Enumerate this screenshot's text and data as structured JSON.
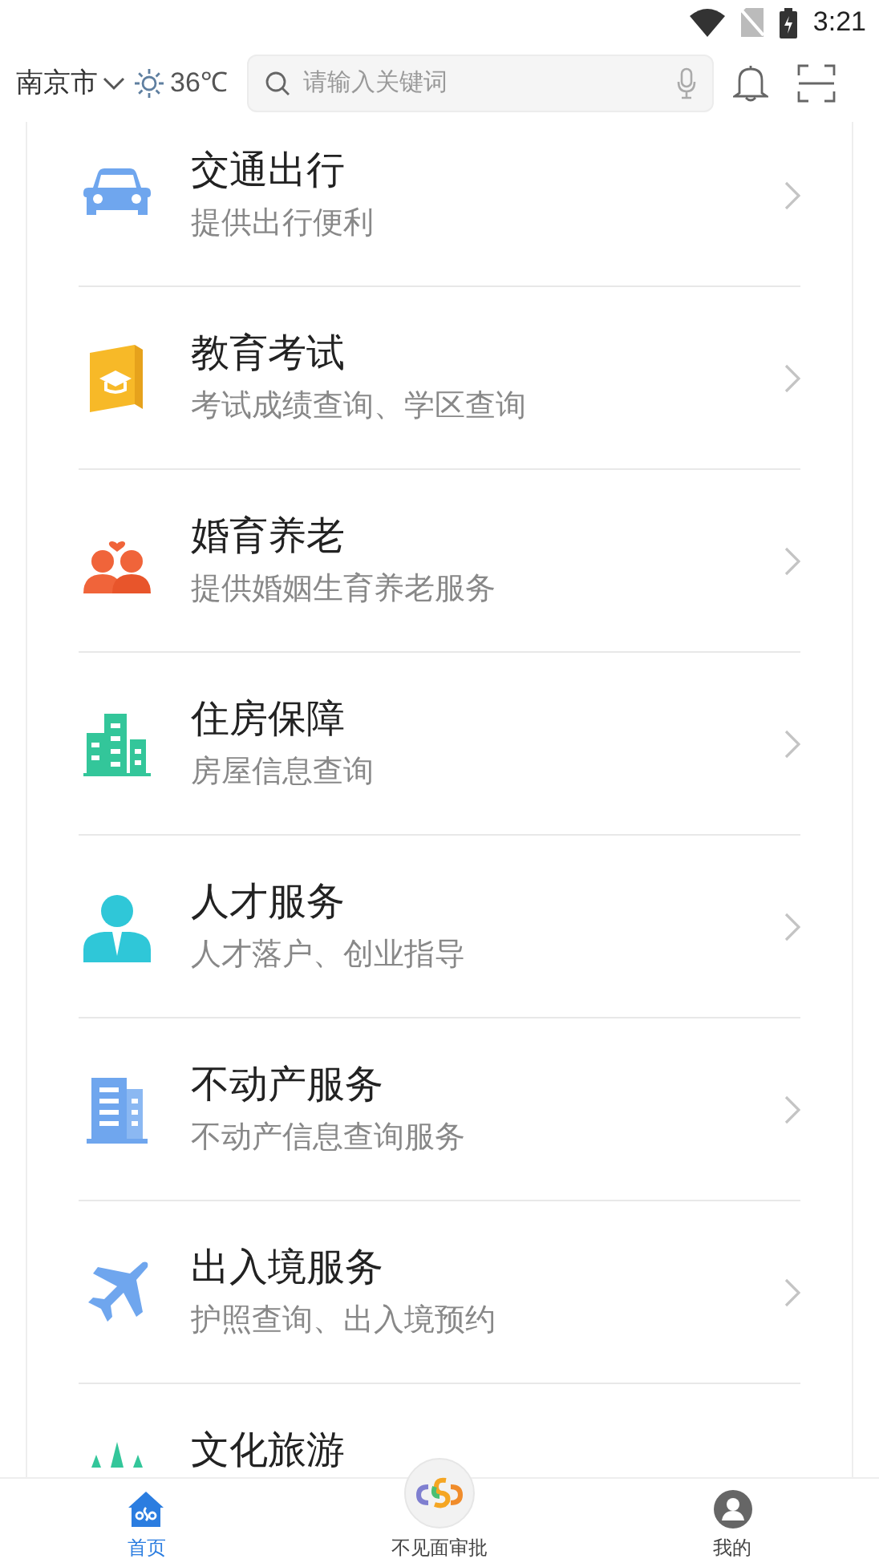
{
  "status_bar": {
    "time": "3:21"
  },
  "header": {
    "city": "南京市",
    "temperature": "36℃",
    "search": {
      "placeholder": "请输入关键词"
    }
  },
  "services": [
    {
      "title": "交通出行",
      "subtitle": "提供出行便利"
    },
    {
      "title": "教育考试",
      "subtitle": "考试成绩查询、学区查询"
    },
    {
      "title": "婚育养老",
      "subtitle": "提供婚姻生育养老服务"
    },
    {
      "title": "住房保障",
      "subtitle": "房屋信息查询"
    },
    {
      "title": "人才服务",
      "subtitle": "人才落户、创业指导"
    },
    {
      "title": "不动产服务",
      "subtitle": "不动产信息查询服务"
    },
    {
      "title": "出入境服务",
      "subtitle": "护照查询、出入境预约"
    },
    {
      "title": "文化旅游"
    }
  ],
  "bottom_nav": [
    {
      "label": "首页",
      "selected": true
    },
    {
      "label": "不见面审批",
      "selected": false
    },
    {
      "label": "我的",
      "selected": false
    }
  ]
}
